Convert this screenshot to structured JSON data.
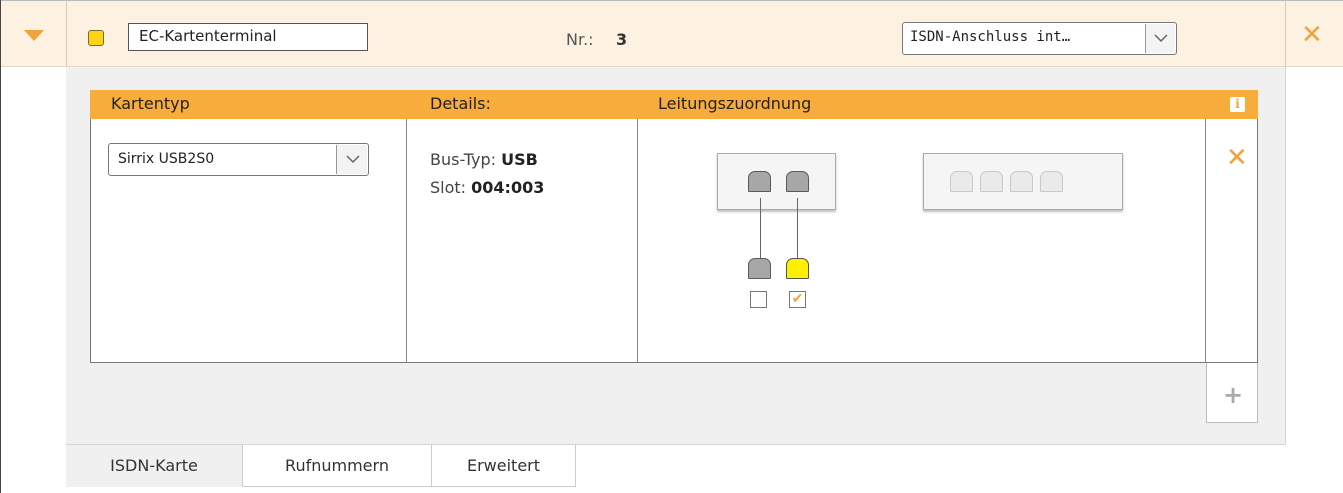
{
  "header": {
    "device_name": "EC-Kartenterminal",
    "nr_label": "Nr.:",
    "nr_value": "3",
    "connection_value": "ISDN-Anschluss int…",
    "status_color": "#ffd21a",
    "accent_color": "#f7ac3b",
    "delete_glyph": "✕"
  },
  "table": {
    "columns": [
      "Kartentyp",
      "Details:",
      "Leitungszuordnung"
    ],
    "info_glyph": "i"
  },
  "card": {
    "type_value": "Sirrix USB2S0",
    "bus_label": "Bus-Typ:",
    "bus_value": "USB",
    "slot_label": "Slot:",
    "slot_value": "004:003",
    "delete_glyph": "✕"
  },
  "ports": {
    "card_ports": 2,
    "free_ports": 4,
    "lines": [
      {
        "assigned": false,
        "jack_color": "#a7a7a7"
      },
      {
        "assigned": true,
        "jack_color": "#fff000"
      }
    ],
    "check_glyph": "✔"
  },
  "add_glyph": "+",
  "tabs": [
    "ISDN-Karte",
    "Rufnummern",
    "Erweitert"
  ],
  "active_tab": "ISDN-Karte",
  "chevron_glyph": "⌄"
}
